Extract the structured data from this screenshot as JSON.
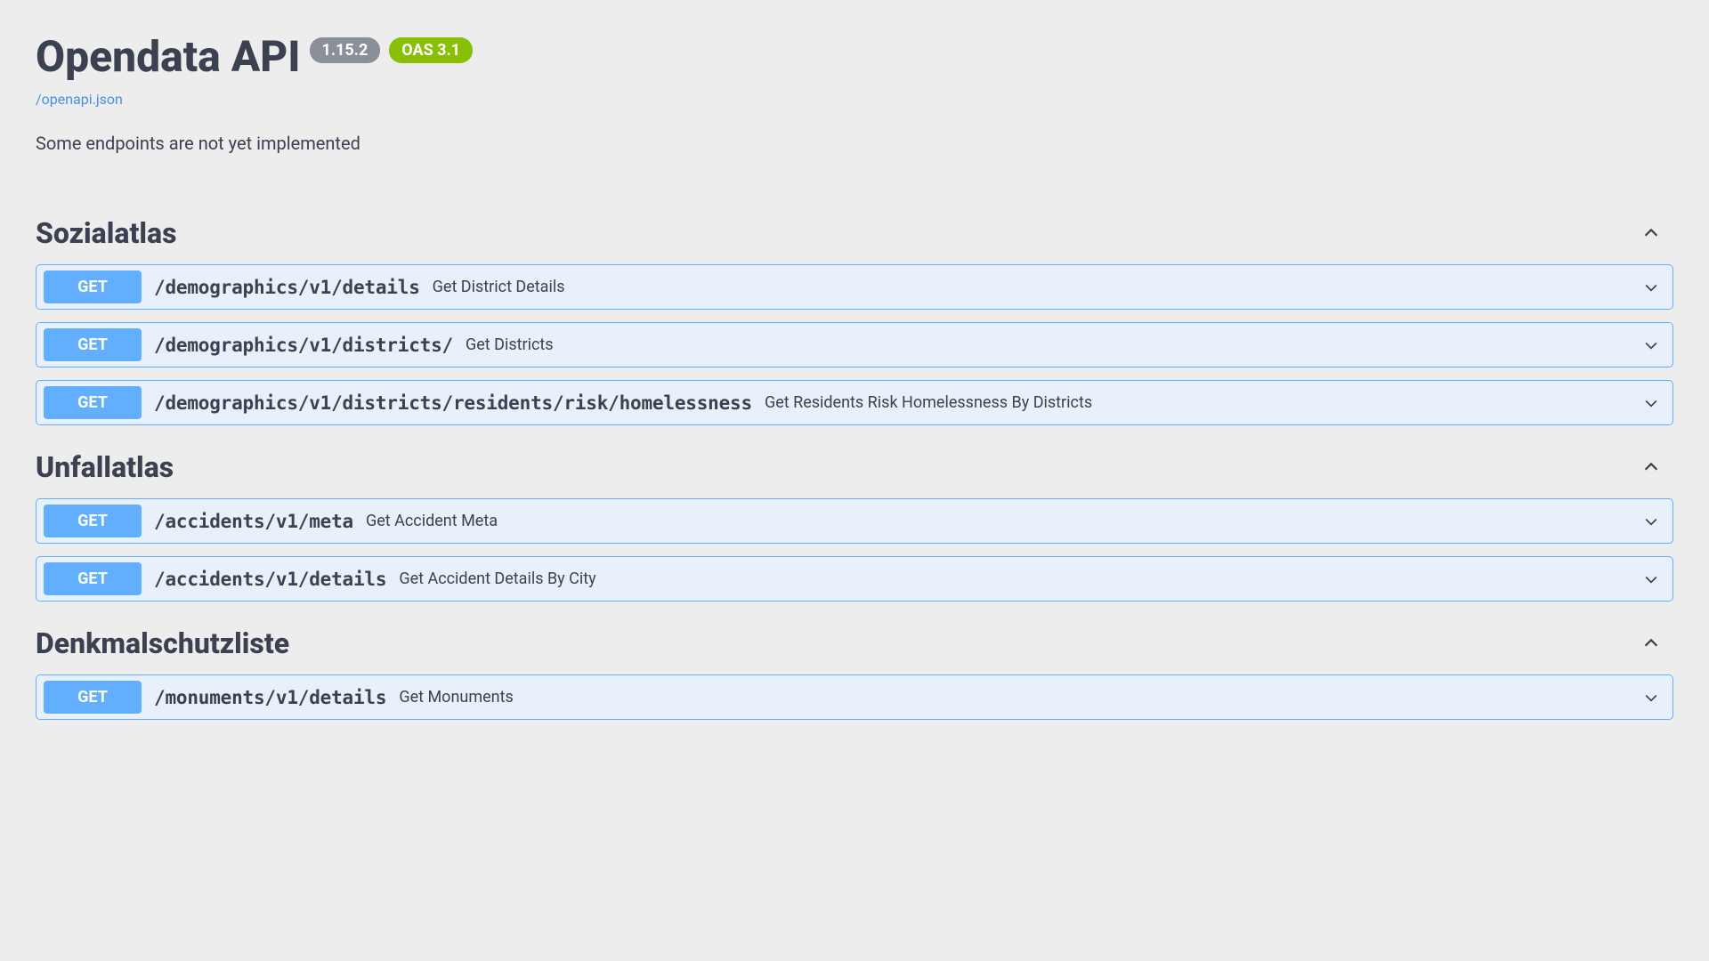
{
  "header": {
    "title": "Opendata API",
    "version_badge": "1.15.2",
    "oas_badge": "OAS 3.1",
    "spec_link": "/openapi.json",
    "description": "Some endpoints are not yet implemented"
  },
  "tags": [
    {
      "name": "Sozialatlas",
      "operations": [
        {
          "method": "GET",
          "path": "/demographics/v1/details",
          "summary": "Get District Details"
        },
        {
          "method": "GET",
          "path": "/demographics/v1/districts/",
          "summary": "Get Districts"
        },
        {
          "method": "GET",
          "path": "/demographics/v1/districts/residents/risk/homelessness",
          "summary": "Get Residents Risk Homelessness By Districts"
        }
      ]
    },
    {
      "name": "Unfallatlas",
      "operations": [
        {
          "method": "GET",
          "path": "/accidents/v1/meta",
          "summary": "Get Accident Meta"
        },
        {
          "method": "GET",
          "path": "/accidents/v1/details",
          "summary": "Get Accident Details By City"
        }
      ]
    },
    {
      "name": "Denkmalschutzliste",
      "operations": [
        {
          "method": "GET",
          "path": "/monuments/v1/details",
          "summary": "Get Monuments"
        }
      ]
    }
  ]
}
